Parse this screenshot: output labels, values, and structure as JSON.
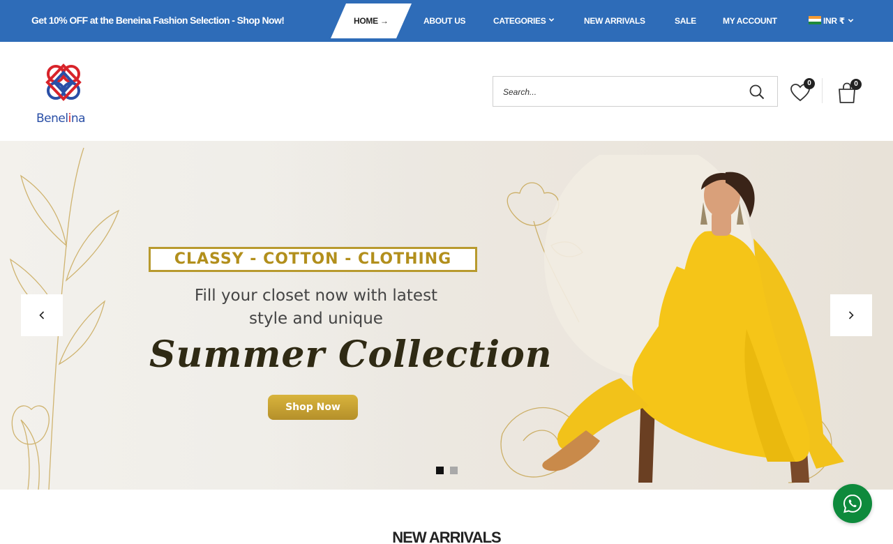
{
  "topbar": {
    "promo_text": "Get 10% OFF at the Beneina Fashion Selection - ",
    "promo_link": "Shop Now!",
    "bg_color": "#2e6cb8"
  },
  "nav": {
    "home": "HOME",
    "about": "ABOUT US",
    "categories": "CATEGORIES",
    "new_arrivals": "NEW ARRIVALS",
    "sale": "SALE",
    "account": "MY ACCOUNT",
    "currency": "INR ₹"
  },
  "header": {
    "logo_text_be": "Be",
    "logo_text_rest": "nel",
    "logo_text_i": "i",
    "logo_text_end": "na",
    "search_placeholder": "Search...",
    "wishlist_count": "0",
    "cart_count": "0"
  },
  "hero": {
    "tagline": "CLASSY - COTTON - CLOTHING",
    "subtitle_line1": "Fill your closet now with latest",
    "subtitle_line2": "style and unique",
    "script_title": "Summer Collection",
    "cta": "Shop Now",
    "active_slide": 1,
    "slides": 2
  },
  "sections": {
    "new_arrivals_title": "NEW ARRIVALS"
  },
  "colors": {
    "accent": "#2e6cb8",
    "gold": "#b89a2e",
    "whatsapp": "#0e8a3c"
  }
}
